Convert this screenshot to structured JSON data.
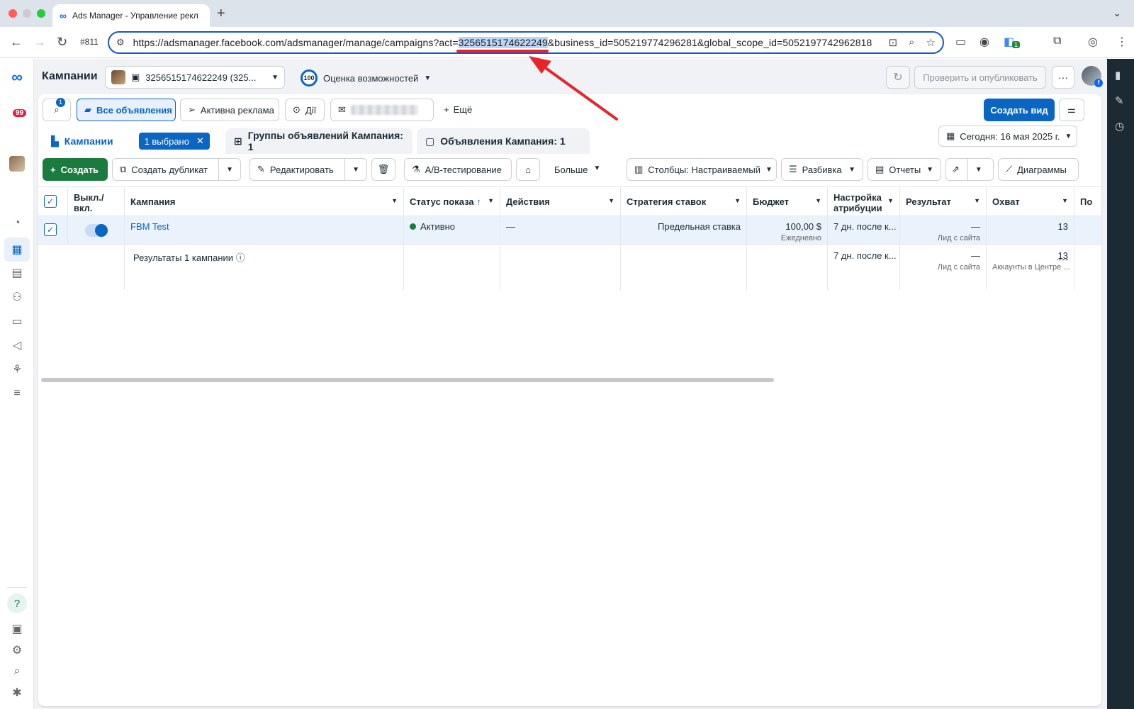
{
  "browser": {
    "tab_title": "Ads Manager - Управление рекл",
    "new_tab": "+",
    "tab_number": "#811",
    "url_prefix": "https://adsmanager.facebook.com/adsmanager/manage/campaigns?act=",
    "url_highlight": "3256515174622249",
    "url_suffix": "&business_id=505219774296281&global_scope_id=5052197742962818",
    "extension_badge": "1"
  },
  "leftnav": {
    "notifications_count": "99"
  },
  "header": {
    "title": "Кампании",
    "account": "3256515174622249 (325...",
    "opportunity_score": "100",
    "opportunity_label": "Оценка возможностей",
    "publish_label": "Проверить и опубликовать",
    "more_label": "···"
  },
  "filters": {
    "search_badge": "1",
    "all_ads": "Все объявления",
    "active_ads": "Активна реклама",
    "actions": "Дії",
    "more": "Ещё",
    "create_view": "Создать вид"
  },
  "level_tabs": {
    "campaigns": "Кампании",
    "selected": "1 выбрано",
    "adsets": "Группы объявлений Кампания: 1",
    "ads": "Объявления Кампания: 1",
    "date": "Сегодня: 16 мая 2025 г."
  },
  "actions": {
    "create": "Создать",
    "duplicate": "Создать дубликат",
    "edit": "Редактировать",
    "ab_test": "A/B-тестирование",
    "more": "Больше",
    "columns": "Столбцы: Настраиваемый",
    "breakdown": "Разбивка",
    "reports": "Отчеты",
    "charts": "Диаграммы"
  },
  "table": {
    "headers": {
      "toggle": "Выкл./ вкл.",
      "campaign": "Кампания",
      "status": "Статус показа",
      "actions": "Действия",
      "bid": "Стратегия ставок",
      "budget": "Бюджет",
      "attribution": "Настройка атрибуции",
      "result": "Результат",
      "reach": "Охват",
      "next": "По"
    },
    "row": {
      "campaign": "FBM Test",
      "status": "Активно",
      "actions": "—",
      "bid": "Предельная ставка",
      "budget": "100,00 $",
      "budget_sub": "Ежедневно",
      "attribution": "7 дн. после к...",
      "result": "—",
      "result_sub": "Лид с сайта",
      "reach": "13"
    },
    "summary": {
      "label": "Результаты 1 кампании",
      "attribution": "7 дн. после к...",
      "result": "—",
      "result_sub": "Лид с сайта",
      "reach": "13",
      "reach_sub": "Аккаунты в Центре ..."
    }
  }
}
